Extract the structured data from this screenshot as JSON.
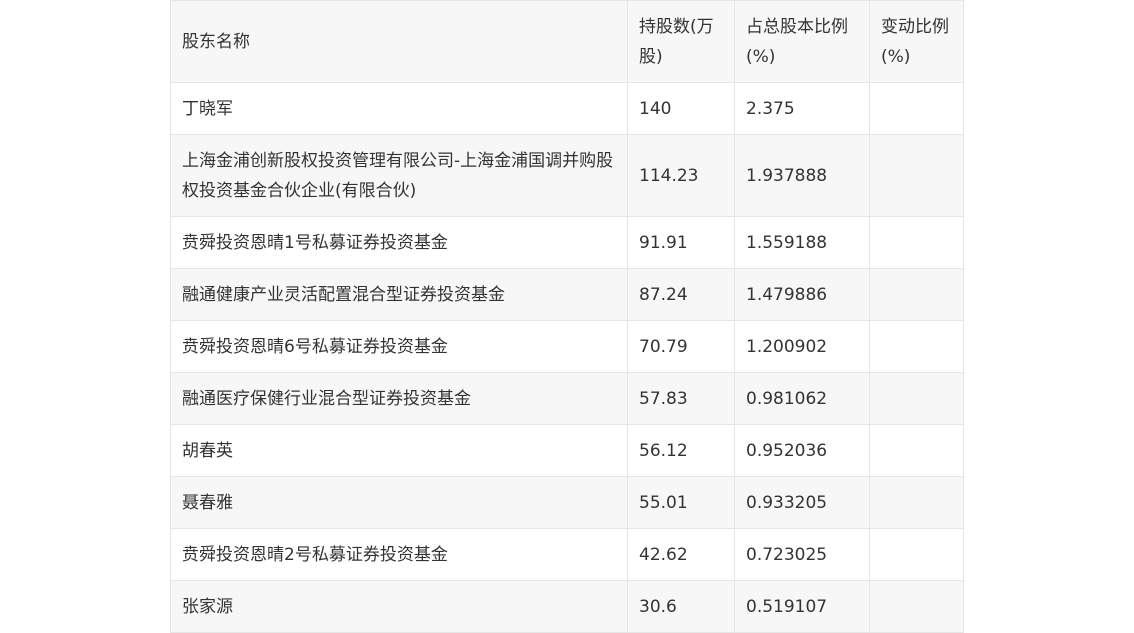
{
  "table": {
    "headers": [
      "股东名称",
      "持股数(万股)",
      "占总股本比例(%)",
      "变动比例(%)"
    ],
    "rows": [
      {
        "name": "丁晓军",
        "shares": "140",
        "ratio": "2.375",
        "change": ""
      },
      {
        "name": "上海金浦创新股权投资管理有限公司-上海金浦国调并购股权投资基金合伙企业(有限合伙)",
        "shares": "114.23",
        "ratio": "1.937888",
        "change": ""
      },
      {
        "name": "贲舜投资恩晴1号私募证券投资基金",
        "shares": "91.91",
        "ratio": "1.559188",
        "change": ""
      },
      {
        "name": "融通健康产业灵活配置混合型证券投资基金",
        "shares": "87.24",
        "ratio": "1.479886",
        "change": ""
      },
      {
        "name": "贲舜投资恩晴6号私募证券投资基金",
        "shares": "70.79",
        "ratio": "1.200902",
        "change": ""
      },
      {
        "name": "融通医疗保健行业混合型证券投资基金",
        "shares": "57.83",
        "ratio": "0.981062",
        "change": ""
      },
      {
        "name": "胡春英",
        "shares": "56.12",
        "ratio": "0.952036",
        "change": ""
      },
      {
        "name": "聂春雅",
        "shares": "55.01",
        "ratio": "0.933205",
        "change": ""
      },
      {
        "name": "贲舜投资恩晴2号私募证券投资基金",
        "shares": "42.62",
        "ratio": "0.723025",
        "change": ""
      },
      {
        "name": "张家源",
        "shares": "30.6",
        "ratio": "0.519107",
        "change": ""
      }
    ]
  }
}
